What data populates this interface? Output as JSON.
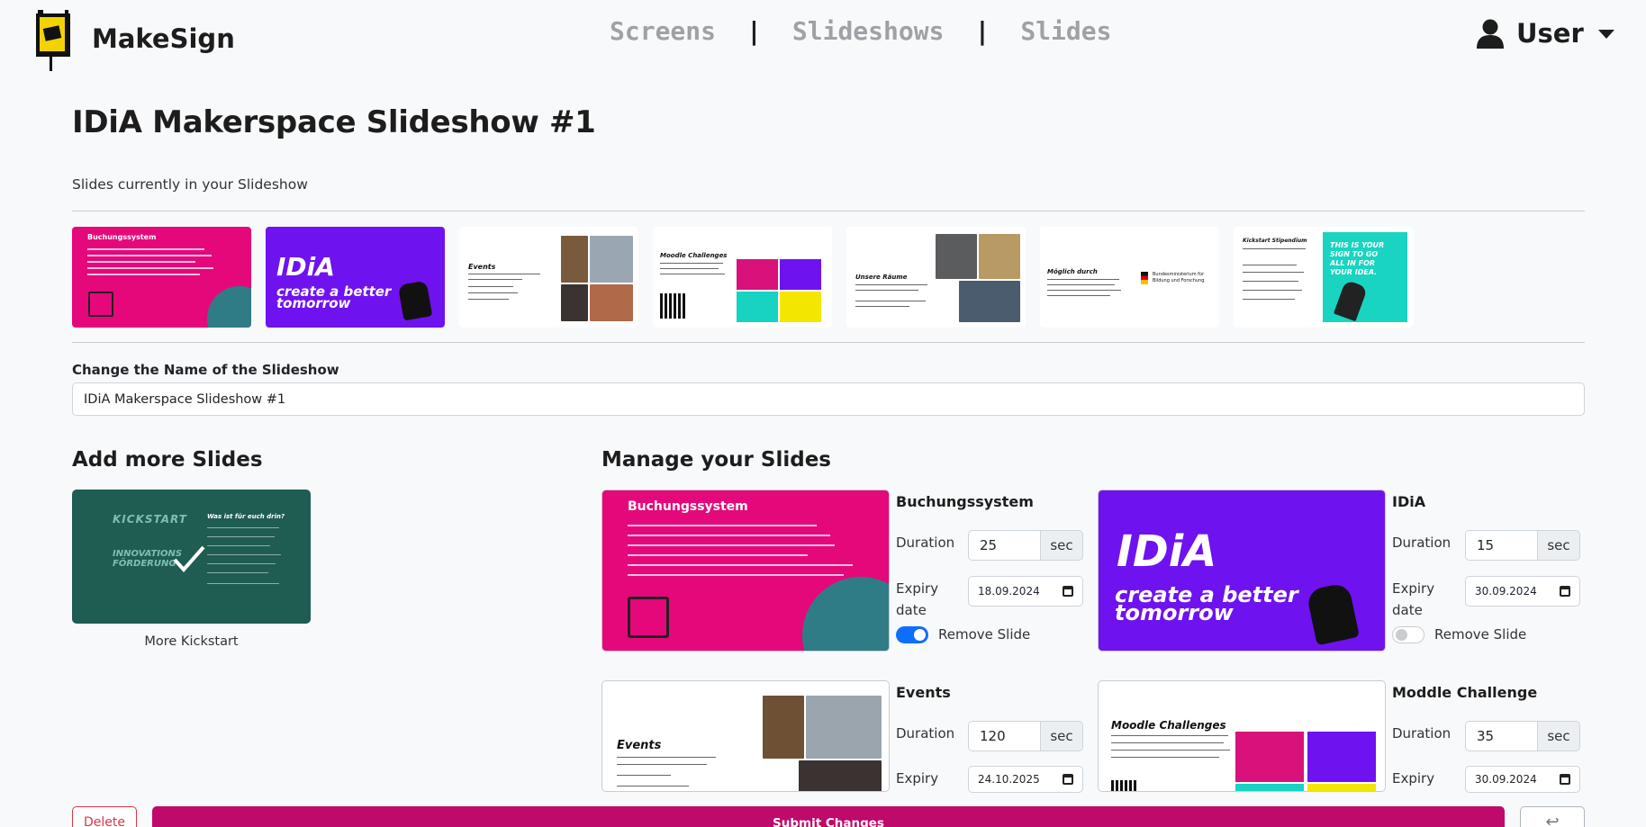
{
  "header": {
    "brand": "MakeSign",
    "nav": [
      "Screens",
      "Slideshows",
      "Slides"
    ],
    "nav_separator": "|",
    "user": "User"
  },
  "page": {
    "title": "IDiA Makerspace Slideshow #1",
    "subtitle": "Slides currently in your Slideshow"
  },
  "strip": [
    {
      "kind": "pink",
      "heading": "Buchungssystem"
    },
    {
      "kind": "purple",
      "heading": "IDiA",
      "tagline": "create a better tomorrow"
    },
    {
      "kind": "white-events",
      "heading": "Events"
    },
    {
      "kind": "white-moodle",
      "heading": "Moodle Challenges"
    },
    {
      "kind": "white-raeume",
      "heading": "Unsere Räume"
    },
    {
      "kind": "white-moeglich",
      "heading": "Möglich durch",
      "sub": "Bundesministerium für Bildung und Forschung"
    },
    {
      "kind": "white-kickstart",
      "heading": "Kickstart Stipendium"
    },
    {
      "kind": "teal-sign",
      "heading": "THIS IS YOUR SIGN TO GO ALL IN FOR YOUR IDEA."
    }
  ],
  "rename": {
    "label": "Change the Name of the Slideshow",
    "value": "IDiA Makerspace Slideshow #1"
  },
  "add": {
    "heading": "Add more Slides",
    "card_heading": "KICKSTART",
    "card_sub": "INNOVATIONS FÖRDERUNG",
    "card_question": "Was ist für euch drin?",
    "caption": "More Kickstart"
  },
  "manage": {
    "heading": "Manage your Slides",
    "duration_label": "Duration",
    "expiry_label_1": "Expiry",
    "expiry_label_2": "date",
    "unit": "sec",
    "remove_label": "Remove Slide",
    "slides": [
      {
        "title": "Buchungssystem",
        "duration": "25",
        "expiry": "18.09.2024",
        "remove": true,
        "art_heading": "Buchungssystem"
      },
      {
        "title": "IDiA",
        "duration": "15",
        "expiry": "30.09.2024",
        "remove": false,
        "art_heading": "IDiA",
        "art_tagline_1": "create a better",
        "art_tagline_2": "tomorrow"
      },
      {
        "title": "Events",
        "duration": "120",
        "expiry": "24.10.2025",
        "art_heading": "Events"
      },
      {
        "title": "Moddle Challenge",
        "duration": "35",
        "expiry": "30.09.2024",
        "art_heading": "Moodle Challenges"
      }
    ]
  },
  "buttons": {
    "delete": "Delete",
    "submit": "Submit Changes",
    "back": "↩"
  },
  "colors": {
    "pink": "#e5087a",
    "purple": "#6f12f0",
    "teal": "#1f5c52",
    "submit": "#be0a6a",
    "toggle_on": "#0d6efd"
  }
}
